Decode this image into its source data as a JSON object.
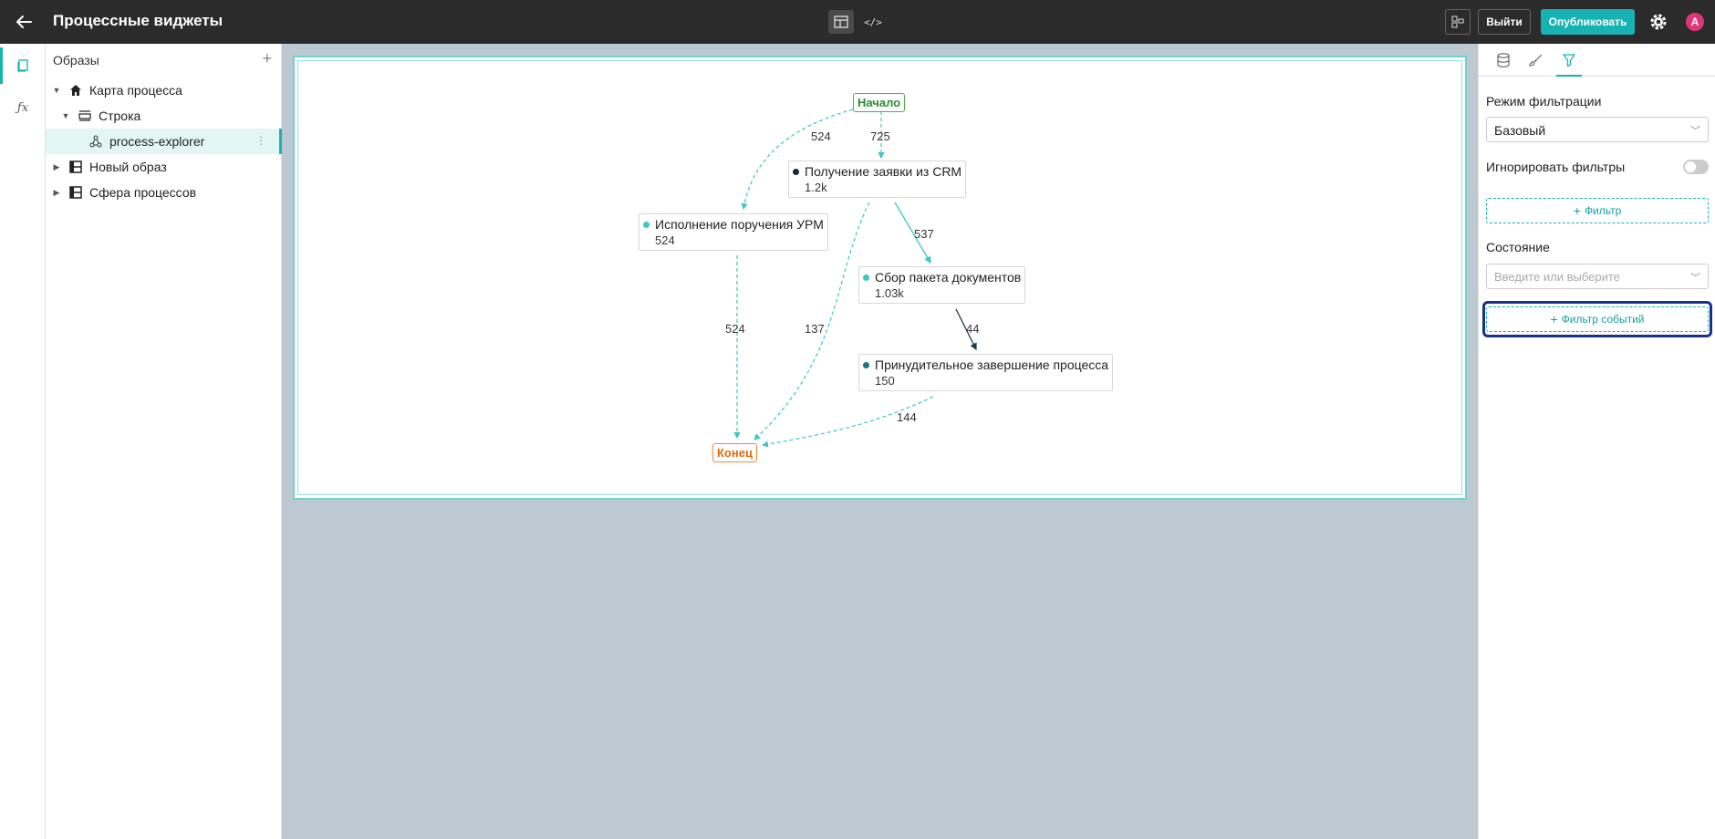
{
  "app": {
    "title": "Процессные виджеты"
  },
  "topbar": {
    "exit_label": "Выйти",
    "publish_label": "Опубликовать",
    "avatar_letter": "A",
    "code_mode_glyph": "</>",
    "accent_color": "#17b3b3"
  },
  "tree": {
    "header": "Образы",
    "add_glyph": "+",
    "items": [
      {
        "label": "Карта процесса",
        "icon": "home-icon",
        "expanded": true
      },
      {
        "label": "Строка",
        "icon": "row-layout-icon",
        "expanded": true
      },
      {
        "label": "process-explorer",
        "icon": "process-graph-icon",
        "selected": true
      },
      {
        "label": "Новый образ",
        "icon": "layout-grid-icon",
        "expanded": false
      },
      {
        "label": "Сфера процессов",
        "icon": "layout-grid-icon",
        "expanded": false
      }
    ]
  },
  "graph": {
    "start": "Начало",
    "end": "Конец",
    "nodes": [
      {
        "name": "Получение заявки из CRM",
        "count": "1.2k",
        "dot_color": "#1a2a3a"
      },
      {
        "name": "Исполнение поручения УРМ",
        "count": "524",
        "dot_color": "#3cc6c6"
      },
      {
        "name": "Сбор пакета документов",
        "count": "1.03k",
        "dot_color": "#3cc6c6"
      },
      {
        "name": "Принудительное завершение процесса",
        "count": "150",
        "dot_color": "#1a7a7a"
      }
    ],
    "edges": [
      {
        "label": "524"
      },
      {
        "label": "725"
      },
      {
        "label": "537"
      },
      {
        "label": "524"
      },
      {
        "label": "137"
      },
      {
        "label": "44"
      },
      {
        "label": "144"
      }
    ]
  },
  "right_panel": {
    "tabs": [
      "database-icon",
      "brush-icon",
      "filter-icon"
    ],
    "filter_mode_label": "Режим фильтрации",
    "filter_mode_value": "Базовый",
    "ignore_filters_label": "Игнорировать фильтры",
    "filter_button": "Фильтр",
    "state_label": "Состояние",
    "state_placeholder": "Введите или выберите",
    "event_filter_button": "Фильтр событий"
  }
}
